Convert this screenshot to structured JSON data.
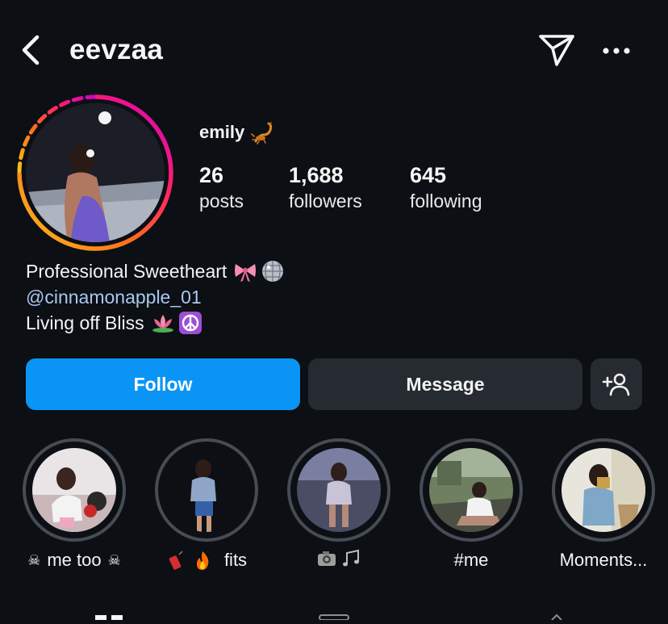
{
  "header": {
    "username": "eevzaa",
    "back_icon": "chevron-left-icon",
    "send_icon": "paper-plane-icon",
    "more_icon": "more-horizontal-icon"
  },
  "profile": {
    "display_name": "emily",
    "name_emoji": "scorpion-emoji",
    "story_ring_colors": [
      "#f9a825",
      "#ff5722",
      "#e91e63",
      "#d300c5"
    ],
    "stats": [
      {
        "value": "26",
        "label": "posts"
      },
      {
        "value": "1,688",
        "label": "followers"
      },
      {
        "value": "645",
        "label": "following"
      }
    ]
  },
  "bio": {
    "line1": "Professional Sweetheart",
    "line1_emojis": [
      "ribbon-emoji",
      "disco-ball-emoji"
    ],
    "mention": "@cinnamonapple_01",
    "line3": "Living off Bliss",
    "line3_emojis": [
      "lotus-emoji",
      "peace-symbol-emoji"
    ]
  },
  "actions": {
    "follow_label": "Follow",
    "message_label": "Message",
    "suggest_icon": "add-person-icon",
    "follow_color": "#0a95f6",
    "secondary_color": "#262a31"
  },
  "highlights": [
    {
      "label": "me too",
      "prefix_emoji": "skull-crossbones-emoji",
      "suffix_emoji": "skull-crossbones-emoji"
    },
    {
      "label": "fits",
      "prefix_emoji": "firecracker-emoji",
      "suffix_emoji": "fire-emoji"
    },
    {
      "label": "",
      "prefix_emoji": "camera-flash-emoji",
      "suffix_emoji": "musical-notes-emoji"
    },
    {
      "label": "#me"
    },
    {
      "label": "Moments..."
    }
  ]
}
